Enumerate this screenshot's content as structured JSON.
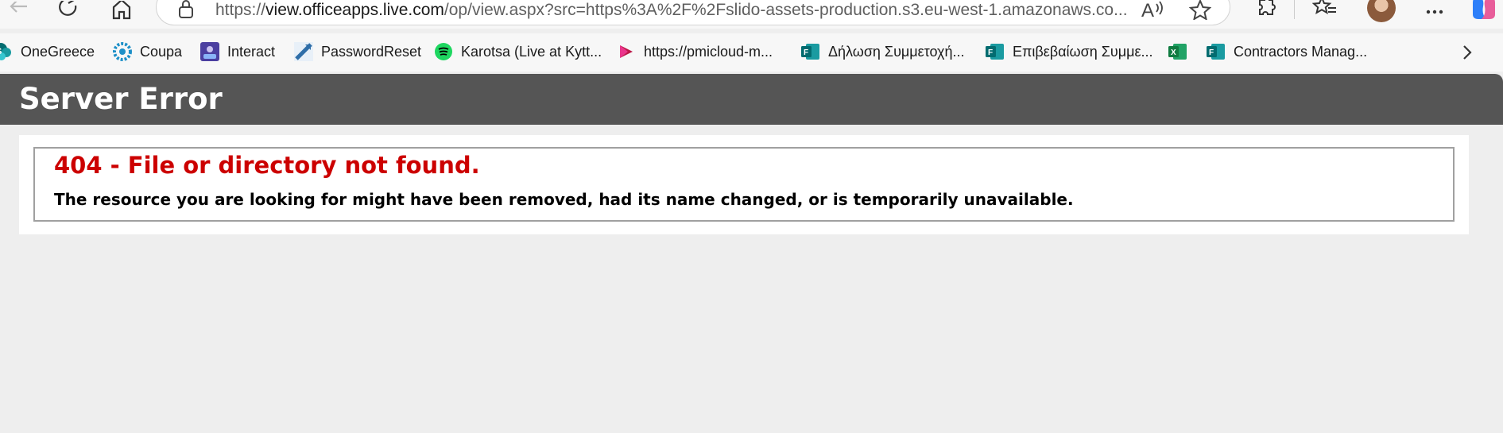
{
  "browser": {
    "url_prefix": "https://",
    "url_host": "view.officeapps.live.com",
    "url_path": "/op/view.aspx?src=https%3A%2F%2Fslido-assets-production.s3.eu-west-1.amazonaws.co...",
    "icons": [
      "back-icon",
      "refresh-icon",
      "home-icon",
      "lock-icon",
      "read-aloud-icon",
      "favorite-star-icon",
      "extensions-icon",
      "favorites-icon",
      "profile-avatar",
      "more-icon",
      "copilot-icon"
    ]
  },
  "bookmarks": [
    {
      "label": "OneGreece",
      "icon": "sharepoint-icon",
      "color": "#038387"
    },
    {
      "label": "Coupa",
      "icon": "coupa-icon",
      "color": "#1e90c8"
    },
    {
      "label": "Interact",
      "icon": "interact-icon",
      "color": "#4b3fa0"
    },
    {
      "label": "PasswordReset",
      "icon": "password-reset-icon",
      "color": "#2f6ea8"
    },
    {
      "label": "Karotsa (Live at Kytt...",
      "icon": "spotify-icon",
      "color": "#1ed760"
    },
    {
      "label": "https://pmicloud-m...",
      "icon": "stream-icon",
      "color": "#bc1948"
    },
    {
      "label": "Δήλωση Συμμετοχή...",
      "icon": "forms-icon",
      "color": "#038387"
    },
    {
      "label": "Επιβεβαίωση Συμμε...",
      "icon": "forms-icon",
      "color": "#038387"
    },
    {
      "label": "",
      "icon": "excel-icon",
      "color": "#107c41"
    },
    {
      "label": "Contractors Manag...",
      "icon": "forms-icon",
      "color": "#038387"
    }
  ],
  "page": {
    "header_title": "Server Error",
    "error_heading": "404 - File or directory not found.",
    "error_message": "The resource you are looking for might have been removed, had its name changed, or is temporarily unavailable."
  },
  "colors": {
    "header_bg": "#555555",
    "error_red": "#cc0000",
    "page_bg": "#eeeeee"
  }
}
